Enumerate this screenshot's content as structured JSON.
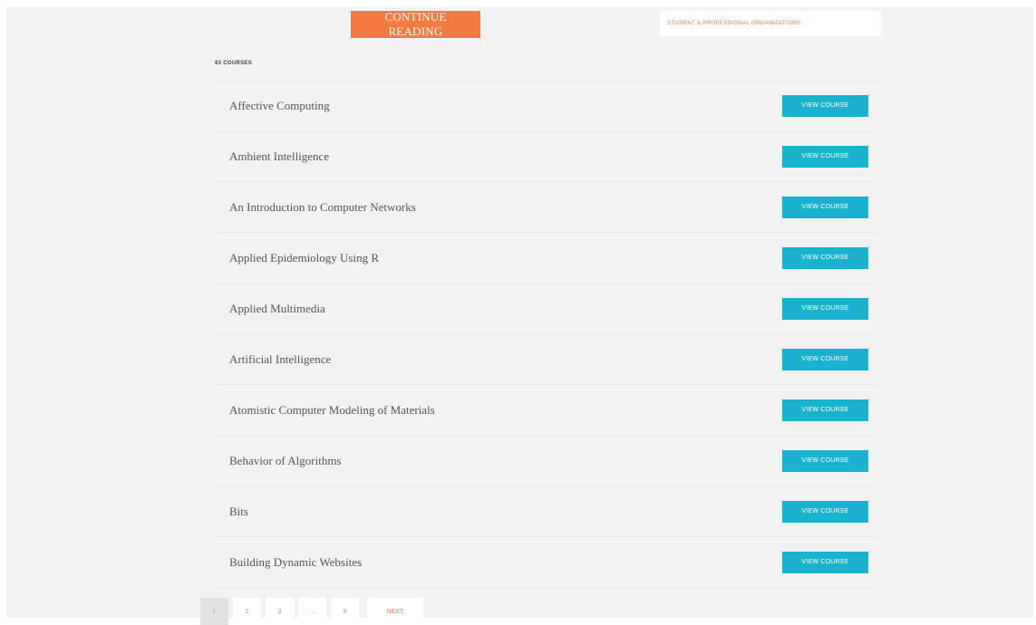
{
  "header": {
    "continue_label": "CONTINUE READING",
    "org_label": "STUDENT & PROFESSIONAL ORGANIZATIONS"
  },
  "course_count": "83 COURSES",
  "courses": [
    {
      "title": "Affective Computing",
      "button": "VIEW COURSE"
    },
    {
      "title": "Ambient Intelligence",
      "button": "VIEW COURSE"
    },
    {
      "title": "An Introduction to Computer Networks",
      "button": "VIEW COURSE"
    },
    {
      "title": "Applied Epidemiology Using R",
      "button": "VIEW COURSE"
    },
    {
      "title": "Applied Multimedia",
      "button": "VIEW COURSE"
    },
    {
      "title": "Artificial Intelligence",
      "button": "VIEW COURSE"
    },
    {
      "title": "Atomistic Computer Modeling of Materials",
      "button": "VIEW COURSE"
    },
    {
      "title": "Behavior of Algorithms",
      "button": "VIEW COURSE"
    },
    {
      "title": "Bits",
      "button": "VIEW COURSE"
    },
    {
      "title": "Building Dynamic Websites",
      "button": "VIEW COURSE"
    }
  ],
  "pagination": {
    "pages": [
      "1",
      "2",
      "3",
      "…",
      "9"
    ],
    "current": "1",
    "next_label": "NEXT"
  },
  "colors": {
    "accent_orange": "#f47a3f",
    "button_teal": "#1ab3cf",
    "background": "#f2f2f2"
  }
}
